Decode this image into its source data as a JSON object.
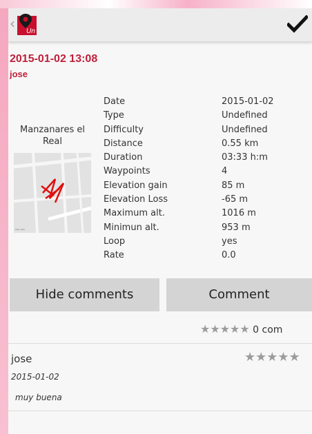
{
  "colors": {
    "accent": "#c0203a",
    "button_bg": "#d4d4d4",
    "star_gray": "#9c9c9c"
  },
  "header": {
    "back_icon": "chevron-left-icon",
    "logo_icon": "map-pin-logo",
    "logo_text": "Un",
    "confirm_icon": "checkmark-icon"
  },
  "route": {
    "title": "2015-01-02 13:08",
    "user": "jose",
    "place": "Manzanares el Real"
  },
  "details": [
    {
      "label": "Date",
      "value": "2015-01-02"
    },
    {
      "label": "Type",
      "value": "Undefined"
    },
    {
      "label": "Difficulty",
      "value": "Undefined"
    },
    {
      "label": "Distance",
      "value": "0.55 km"
    },
    {
      "label": "Duration",
      "value": "03:33 h:m"
    },
    {
      "label": "Waypoints",
      "value": "4"
    },
    {
      "label": "Elevation gain",
      "value": "85 m"
    },
    {
      "label": "Elevation Loss",
      "value": "-65 m"
    },
    {
      "label": "Maximum alt.",
      "value": "1016 m"
    },
    {
      "label": "Minimun alt.",
      "value": "953 m"
    },
    {
      "label": "Loop",
      "value": "yes"
    },
    {
      "label": "Rate",
      "value": "0.0"
    }
  ],
  "buttons": {
    "hide_comments": "Hide comments",
    "comment": "Comment"
  },
  "rating": {
    "stars": "★★★★★",
    "count_text": "0 com",
    "value": 0
  },
  "comments": [
    {
      "user": "jose",
      "date": "2015-01-02",
      "text": "muy buena",
      "stars": "★★★★★"
    }
  ]
}
